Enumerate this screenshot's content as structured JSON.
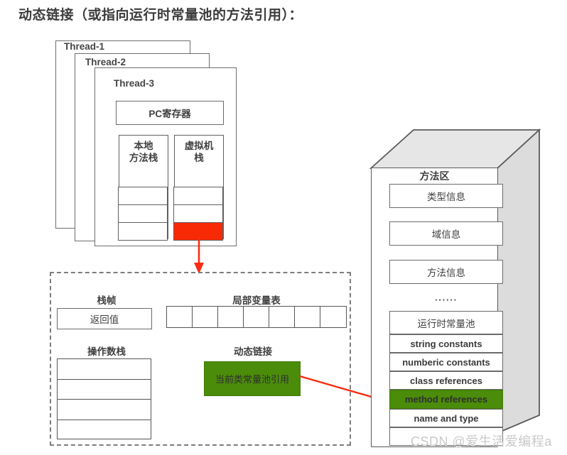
{
  "title": "动态链接（或指向运行时常量池的方法引用）：",
  "threads": {
    "cards": [
      {
        "label": "Thread-1"
      },
      {
        "label": "Thread-2"
      },
      {
        "label": "Thread-3"
      }
    ],
    "pc_register": "PC寄存器",
    "native_stack": {
      "title": "本地\n方法栈",
      "line1": "本地",
      "line2": "方法栈",
      "slots": 3,
      "highlight_index": -1
    },
    "vm_stack": {
      "title": "虚拟机\n栈",
      "line1": "虚拟机",
      "line2": "栈",
      "slots": 3,
      "highlight_index": 2
    }
  },
  "stack_frame": {
    "frame_label": "栈帧",
    "return_value": "返回值",
    "local_var_label": "局部变量表",
    "local_var_cells": 7,
    "operand_stack_label": "操作数栈",
    "operand_stack_rows": 4,
    "dynamic_link_label": "动态链接",
    "dynamic_link_box": "当前类常量池引用"
  },
  "method_area": {
    "title": "方法区",
    "rows": [
      {
        "text": "类型信息",
        "style": "cn"
      },
      {
        "text": "域信息",
        "style": "cn"
      },
      {
        "text": "方法信息",
        "style": "cn"
      }
    ],
    "ellipsis": "······",
    "constant_pool": [
      {
        "text": "运行时常量池",
        "style": "cn"
      },
      {
        "text": "string constants",
        "style": "en"
      },
      {
        "text": "numberic constants",
        "style": "en"
      },
      {
        "text": "class references",
        "style": "en"
      },
      {
        "text": "method references",
        "style": "en-green"
      },
      {
        "text": "name and type",
        "style": "en"
      },
      {
        "text": "",
        "style": "en"
      }
    ]
  },
  "watermark": "CSDN @爱生活爱编程a",
  "colors": {
    "highlight_red": "#f82a05",
    "highlight_green": "#4b8c0a",
    "arrow_red": "#fb2c11",
    "box_border": "#6b6b6b",
    "box_3d_top": "#e6e6e6",
    "box_3d_side": "#dcdcdc"
  }
}
